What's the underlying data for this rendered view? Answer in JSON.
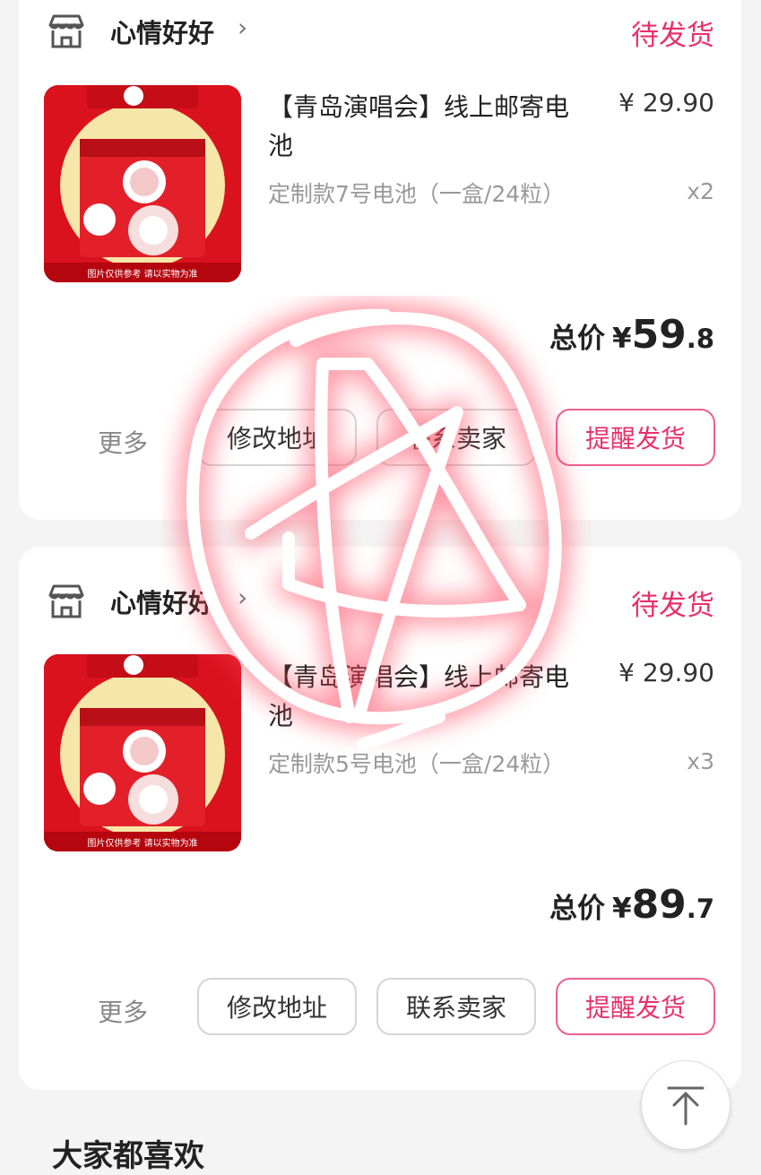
{
  "orders": [
    {
      "shop_name": "心情好好",
      "shop_chevron": "›",
      "status": "待发货",
      "title": "【青岛演唱会】线上邮寄电池",
      "price": "¥ 29.90",
      "spec": "定制款7号电池（一盒/24粒）",
      "qty": "x2",
      "total_label": "总价",
      "total_currency": "¥",
      "total_int": "59",
      "total_dec": ".8",
      "more_label": "更多",
      "btn_address": "修改地址",
      "btn_contact": "联系卖家",
      "btn_remind": "提醒发货",
      "image_caption": "图片仅供参考 请以实物为准"
    },
    {
      "shop_name": "心情好好",
      "shop_chevron": "›",
      "status": "待发货",
      "title": "【青岛演唱会】线上邮寄电池",
      "price": "¥ 29.90",
      "spec": "定制款5号电池（一盒/24粒）",
      "qty": "x3",
      "total_label": "总价",
      "total_currency": "¥",
      "total_int": "89",
      "total_dec": ".7",
      "more_label": "更多",
      "btn_address": "修改地址",
      "btn_contact": "联系卖家",
      "btn_remind": "提醒发货",
      "image_caption": "图片仅供参考 请以实物为准"
    }
  ],
  "next_section_title": "大家都喜欢",
  "colors": {
    "accent": "#e8306a",
    "product_red": "#d9121d",
    "card_bg": "#ffffff",
    "page_bg": "#f4f4f4"
  },
  "icons": {
    "shop": "shop-icon",
    "back_to_top": "arrow-up-to-top-icon",
    "chevron": "chevron-right-icon"
  }
}
